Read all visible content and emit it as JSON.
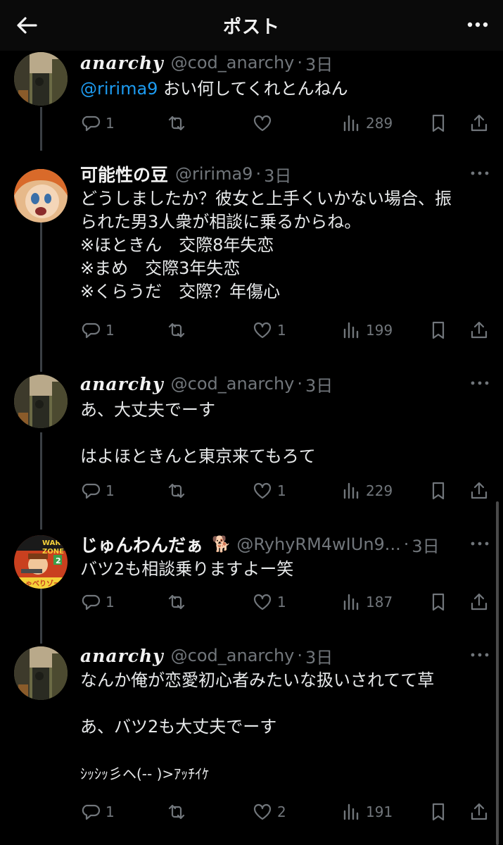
{
  "header": {
    "title": "ポスト",
    "back_icon": "arrow-left-icon",
    "more_icon": "more-horizontal-icon"
  },
  "posts": [
    {
      "name": "anarchy",
      "handle": "@cod_anarchy",
      "date": "3日",
      "mention": "@ririma9",
      "text": " おい何してくれとんねん",
      "replies": "1",
      "likes": "",
      "views": "289"
    },
    {
      "name": "可能性の豆",
      "handle": "@ririma9",
      "date": "3日",
      "text": "どうしましたか？彼女と上手くいかない場合、振\nられた男3人衆が相談に乗るからね。\n※ほときん　交際8年失恋\n※まめ　交際3年失恋\n※くらうだ　交際？年傷心",
      "replies": "1",
      "likes": "1",
      "views": "199"
    },
    {
      "name": "anarchy",
      "handle": "@cod_anarchy",
      "date": "3日",
      "text": "あ、大丈夫でーす\n\nはよほときんと東京来てもろて",
      "replies": "1",
      "likes": "1",
      "views": "229"
    },
    {
      "name": "じゅんわんだぁ",
      "name_emoji": "🐕",
      "handle": "@RyhyRM4wIUn9...",
      "date": "3日",
      "avatar_texts": [
        "WAR",
        "ZONE",
        "2",
        "しゃべりゾー"
      ],
      "text": "バツ2も相談乗りますよー笑",
      "replies": "1",
      "likes": "1",
      "views": "187"
    },
    {
      "name": "anarchy",
      "handle": "@cod_anarchy",
      "date": "3日",
      "text": "なんか俺が恋愛初心者みたいな扱いされてて草\n\nあ、バツ2も大丈夫でーす\n\n",
      "text_tail": "ｼｯｼｯ彡ヘ(-- )>ｱｯﾁｲｹ",
      "replies": "1",
      "likes": "2",
      "views": "191"
    }
  ],
  "icons": {
    "reply": "reply-icon",
    "retweet": "repost-icon",
    "like": "heart-icon",
    "views": "views-icon",
    "bookmark": "bookmark-icon",
    "share": "share-icon"
  },
  "colors": {
    "background": "#000000",
    "text": "#e7e9ea",
    "muted": "#71767b",
    "mention": "#1d9bf0"
  }
}
